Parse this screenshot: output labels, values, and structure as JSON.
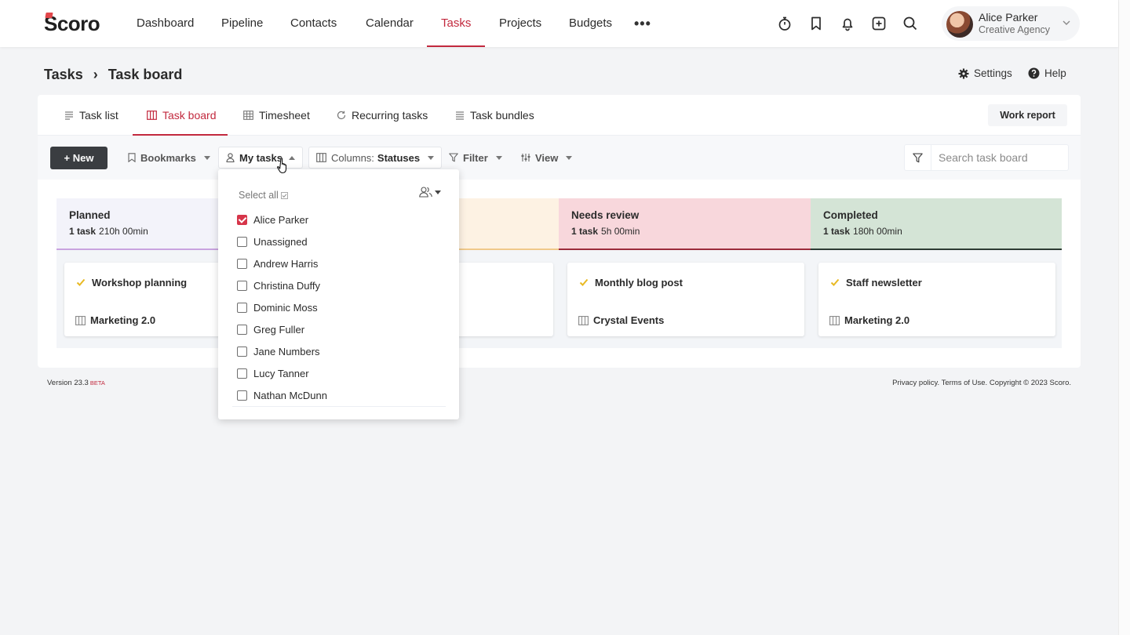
{
  "nav": {
    "logo": "Scoro",
    "items": [
      "Dashboard",
      "Pipeline",
      "Contacts",
      "Calendar",
      "Tasks",
      "Projects",
      "Budgets"
    ],
    "active": "Tasks",
    "more": "•••"
  },
  "user": {
    "name": "Alice Parker",
    "org": "Creative Agency"
  },
  "breadcrumb": {
    "root": "Tasks",
    "separator": "›",
    "current": "Task board"
  },
  "header_links": {
    "settings": "Settings",
    "help": "Help"
  },
  "tabs": {
    "items": [
      "Task list",
      "Task board",
      "Timesheet",
      "Recurring tasks",
      "Task bundles"
    ],
    "active": "Task board",
    "work_report": "Work report"
  },
  "toolbar": {
    "new": "+ New",
    "bookmarks": "Bookmarks",
    "my_tasks": "My tasks",
    "columns_label": "Columns:",
    "columns_value": "Statuses",
    "filter": "Filter",
    "view": "View",
    "search_placeholder": "Search task board"
  },
  "board": {
    "columns": [
      {
        "title": "Planned",
        "count": "1 task",
        "hours": "210h 00min",
        "bg": "#f3f3fa",
        "line": "#c9a3e0"
      },
      {
        "title": "",
        "count": "",
        "hours": "",
        "bg": "#fdf2e3",
        "line": "#f0c98a"
      },
      {
        "title": "Needs review",
        "count": "1 task",
        "hours": "5h 00min",
        "bg": "#f8d7dc",
        "line": "#9c2b3b"
      },
      {
        "title": "Completed",
        "count": "1 task",
        "hours": "180h 00min",
        "bg": "#d4e4d6",
        "line": "#2d3b33"
      }
    ],
    "cards": [
      {
        "title": "Workshop planning",
        "project": "Marketing 2.0"
      },
      {
        "title": "",
        "project": ""
      },
      {
        "title": "Monthly blog post",
        "project": "Crystal Events"
      },
      {
        "title": "Staff newsletter",
        "project": "Marketing 2.0"
      }
    ]
  },
  "dropdown": {
    "select_all": "Select all",
    "people": [
      {
        "name": "Alice Parker",
        "checked": true
      },
      {
        "name": "Unassigned",
        "checked": false
      },
      {
        "name": "Andrew Harris",
        "checked": false
      },
      {
        "name": "Christina Duffy",
        "checked": false
      },
      {
        "name": "Dominic Moss",
        "checked": false
      },
      {
        "name": "Greg Fuller",
        "checked": false
      },
      {
        "name": "Jane Numbers",
        "checked": false
      },
      {
        "name": "Lucy Tanner",
        "checked": false
      },
      {
        "name": "Nathan McDunn",
        "checked": false
      }
    ]
  },
  "footer": {
    "version": "Version 23.3",
    "beta": "BETA",
    "legal": "Privacy policy. Terms of Use. Copyright © 2023 Scoro."
  },
  "colors": {
    "accent": "#c2293e",
    "checkbox": "#d6354a",
    "dark_button": "#3a3d41",
    "check_yellow": "#e8b923"
  }
}
